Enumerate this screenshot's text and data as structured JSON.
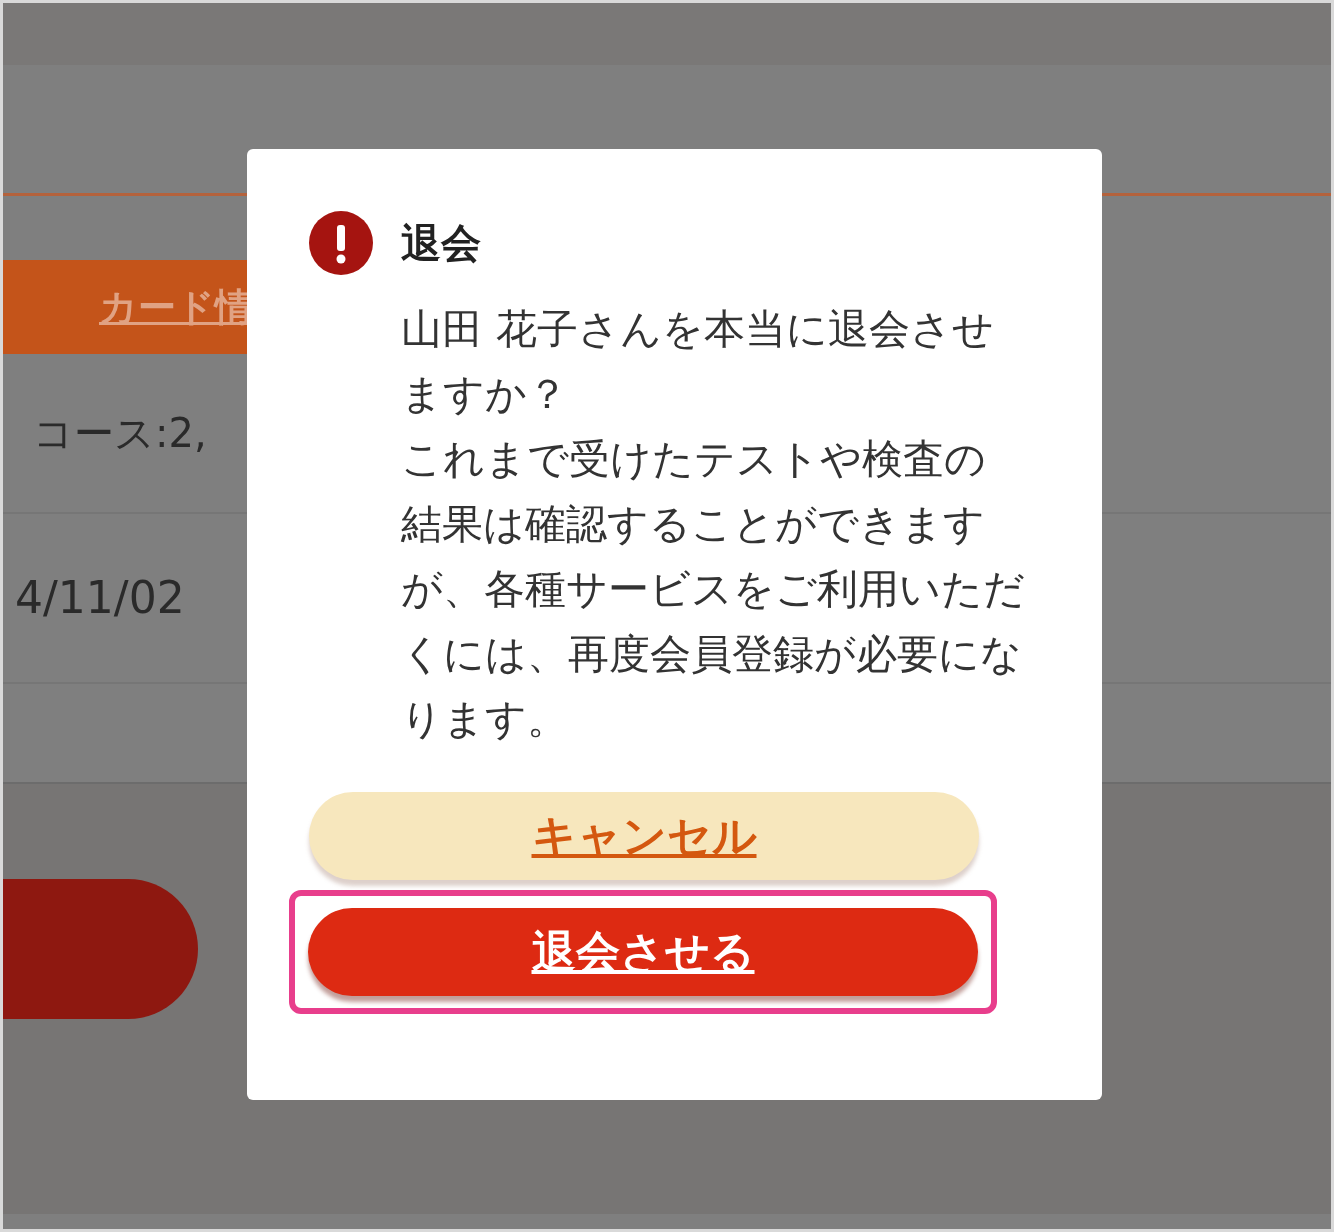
{
  "background": {
    "card_link": "カード情",
    "plan_text": "コース:2,",
    "date_text": "4/11/02"
  },
  "dialog": {
    "title": "退会",
    "message": [
      "山田 花子さんを本当に退会させますか？",
      "これまで受けたテストや検査の結果は確認することができますが、各種サービスをご利用いただくには、再度会員登録が必要になります。"
    ],
    "buttons": [
      {
        "kind": "secondary",
        "label": "キャンセル",
        "highlighted": false
      },
      {
        "kind": "danger",
        "label": "退会させる",
        "highlighted": true
      }
    ]
  }
}
